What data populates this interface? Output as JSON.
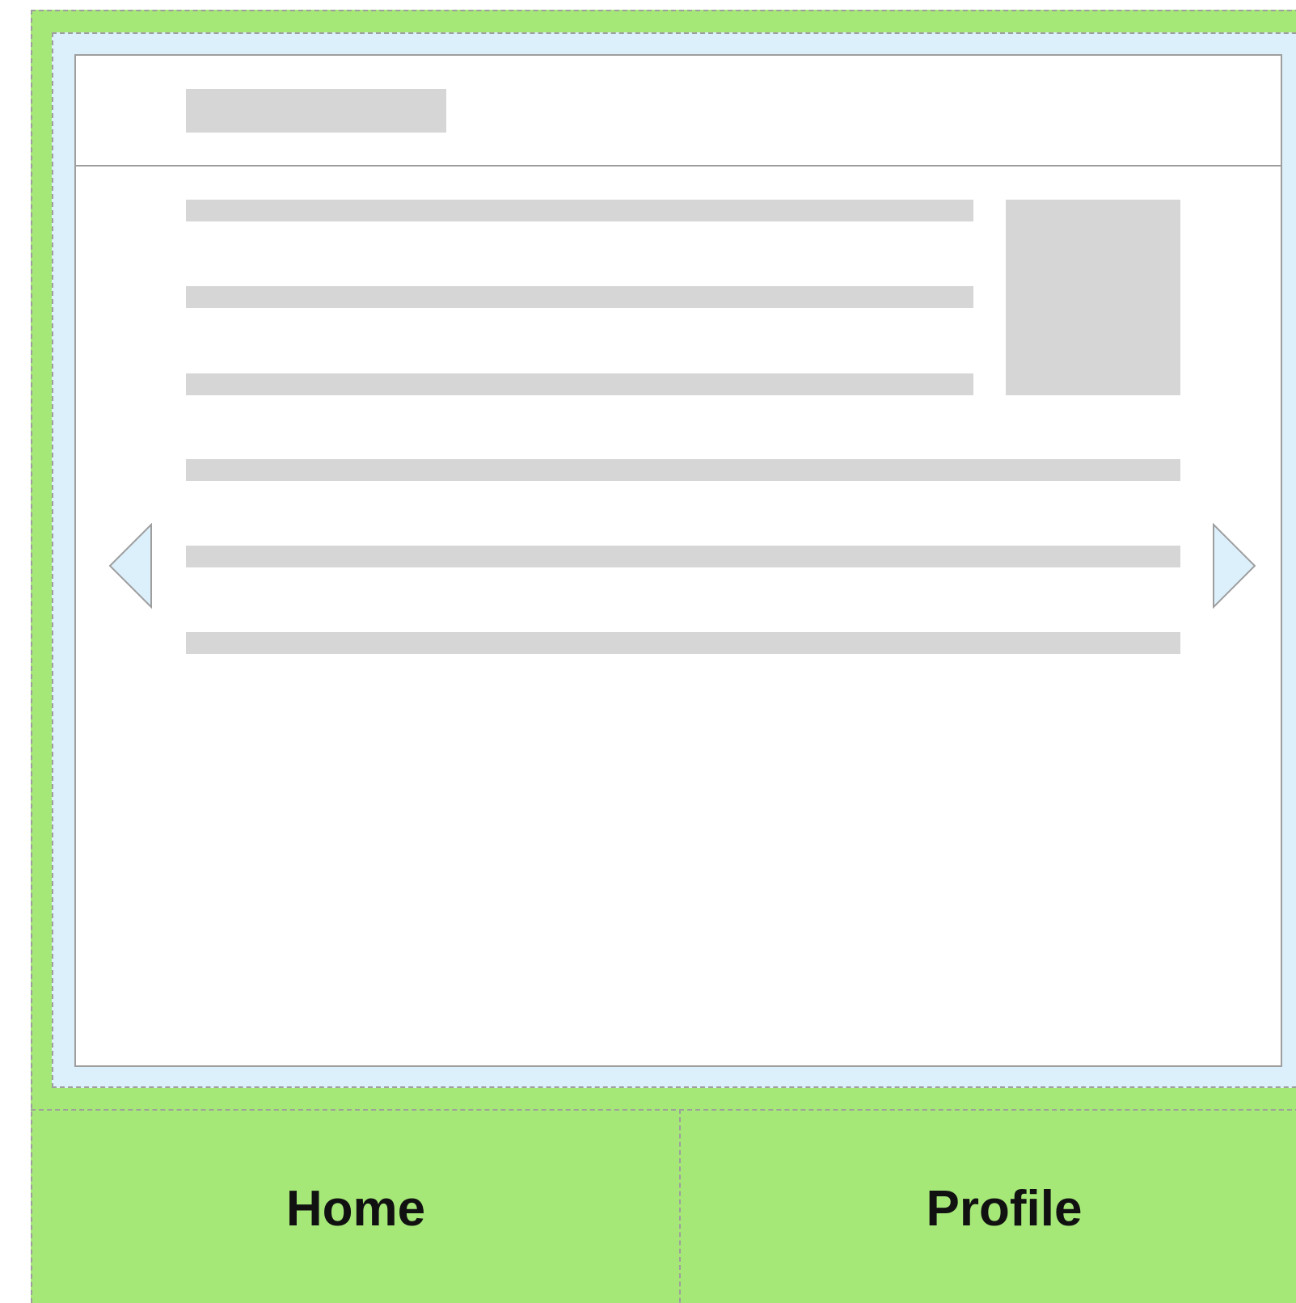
{
  "bottom_nav": {
    "items": [
      {
        "label": "Home"
      },
      {
        "label": "Profile"
      }
    ]
  },
  "carousel": {
    "prev_icon": "chevron-left-icon",
    "next_icon": "chevron-right-icon"
  },
  "colors": {
    "frame_green": "#a6e878",
    "container_blue": "#dcf0fc",
    "placeholder_gray": "#d6d6d6",
    "border_gray": "#9e9e9e"
  }
}
